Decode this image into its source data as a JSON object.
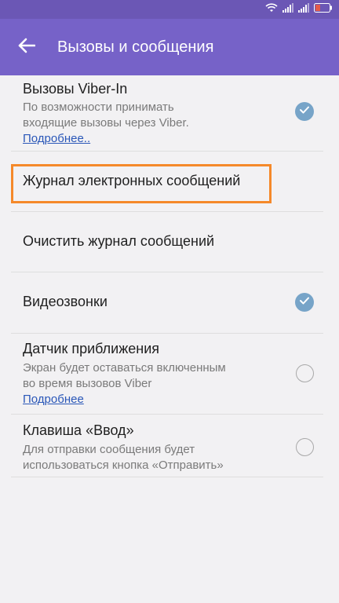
{
  "header": {
    "title": "Вызовы и сообщения",
    "back_icon": "arrow-back-icon"
  },
  "status_bar": {
    "battery_color": "#e25a4a",
    "icons": [
      "wifi-icon",
      "signal-icon",
      "signal-icon",
      "battery-icon"
    ]
  },
  "settings": {
    "viber_in": {
      "title": "Вызовы Viber-In",
      "subtitle_line1": "По возможности принимать",
      "subtitle_line2": "входящие вызовы через Viber.",
      "link": "Подробнее..",
      "checked": true
    },
    "email_log": {
      "title": "Журнал электронных сообщений"
    },
    "clear_log": {
      "title": "Очистить журнал сообщений"
    },
    "video_calls": {
      "title": "Видеозвонки",
      "checked": true
    },
    "proximity": {
      "title": "Датчик приближения",
      "subtitle_line1": "Экран будет оставаться включенным",
      "subtitle_line2": "во время вызовов Viber",
      "link": "Подробнее",
      "checked": false
    },
    "enter_key": {
      "title": "Клавиша «Ввод»",
      "subtitle_line1": "Для отправки сообщения будет",
      "subtitle_line2": "использоваться кнопка «Отправить»",
      "checked": false
    }
  },
  "colors": {
    "appbar": "#7662c8",
    "statusbar": "#6b57b5",
    "checkbox_on": "#77a4c8",
    "highlight": "#f5892a",
    "link": "#2a57b8"
  }
}
